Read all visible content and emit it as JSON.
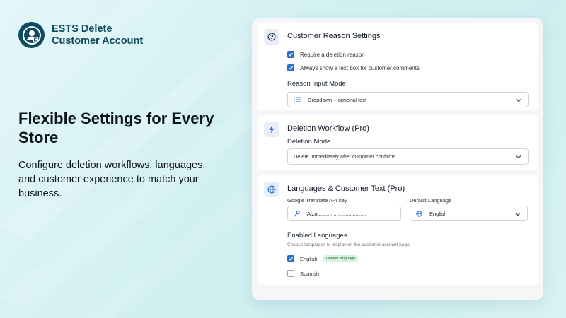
{
  "brand": {
    "name": "ESTS Delete Customer Account"
  },
  "hero": {
    "title": "Flexible Settings for Every Store",
    "subtitle": "Configure deletion workflows, languages, and customer experience to match your business."
  },
  "customer_reason": {
    "title": "Customer Reason Settings",
    "icon": "question-circle-icon",
    "options": [
      {
        "label": "Require a deletion reason",
        "checked": true
      },
      {
        "label": "Always show a text box for customer comments",
        "checked": true
      }
    ],
    "input_mode_label": "Reason Input Mode",
    "input_mode_value": "Dropdown + optional text"
  },
  "deletion_workflow": {
    "title": "Deletion Workflow (Pro)",
    "icon": "lightning-icon",
    "mode_label": "Deletion Mode",
    "mode_value": "Delete immediately after customer confirms"
  },
  "languages": {
    "title": "Languages & Customer Text (Pro)",
    "icon": "globe-icon",
    "api_key_label": "Google Translate API key",
    "api_key_value": "Alza.................................",
    "default_language_label": "Default Language",
    "default_language_value": "English",
    "enabled_title": "Enabled Languages",
    "enabled_help": "Choose languages to display on the customer account page.",
    "items": [
      {
        "label": "English",
        "checked": true,
        "badge": "Default language"
      },
      {
        "label": "Spanish",
        "checked": false
      }
    ]
  },
  "colors": {
    "accent": "#2c6ecb",
    "brand": "#0f4a5f",
    "badge_bg": "#d7f2de"
  }
}
